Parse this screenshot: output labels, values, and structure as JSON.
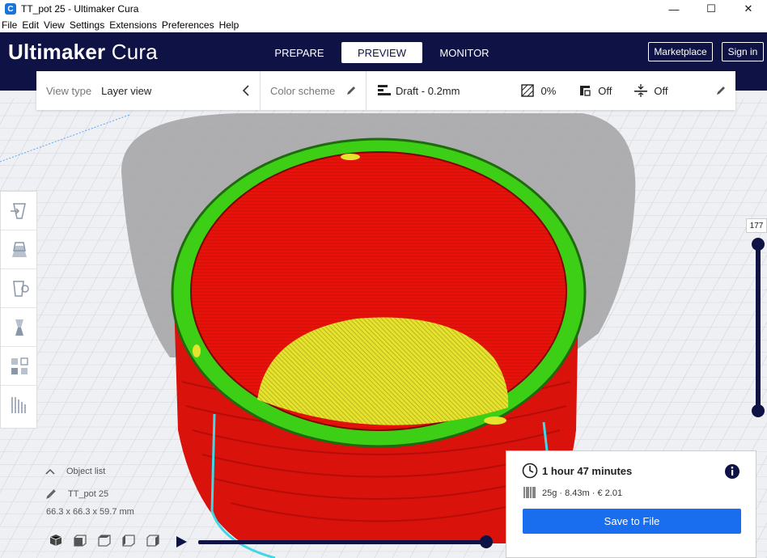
{
  "window": {
    "title": "TT_pot 25 - Ultimaker Cura",
    "app_icon": "C",
    "controls": [
      "—",
      "☐",
      "✕"
    ]
  },
  "menu": [
    "File",
    "Edit",
    "View",
    "Settings",
    "Extensions",
    "Preferences",
    "Help"
  ],
  "header": {
    "brand_bold": "Ultimaker",
    "brand_light": "Cura",
    "tabs": [
      {
        "label": "PREPARE",
        "active": false
      },
      {
        "label": "PREVIEW",
        "active": true
      },
      {
        "label": "MONITOR",
        "active": false
      }
    ],
    "marketplace_label": "Marketplace",
    "signin_label": "Sign in"
  },
  "toolbar": {
    "view_type_label": "View type",
    "view_type_value": "Layer view",
    "color_scheme_label": "Color scheme",
    "profile": "Draft - 0.2mm",
    "infill": "0%",
    "support": "Off",
    "adhesion": "Off"
  },
  "layer_slider": {
    "current_layer": "177"
  },
  "object_list": {
    "header": "Object list",
    "object_name": "TT_pot 25",
    "dimensions": "66.3 x 66.3 x 59.7 mm"
  },
  "job": {
    "print_time": "1 hour 47 minutes",
    "material": "25g · 8.43m · € 2.01",
    "save_label": "Save to File"
  },
  "colors": {
    "header_bg": "#0f1245",
    "accent": "#196ef0",
    "wall_red": "#e8120b",
    "wall_green": "#3ccf16",
    "infill_yellow": "#e6e32e",
    "travel_cyan": "#3fd8e6"
  }
}
